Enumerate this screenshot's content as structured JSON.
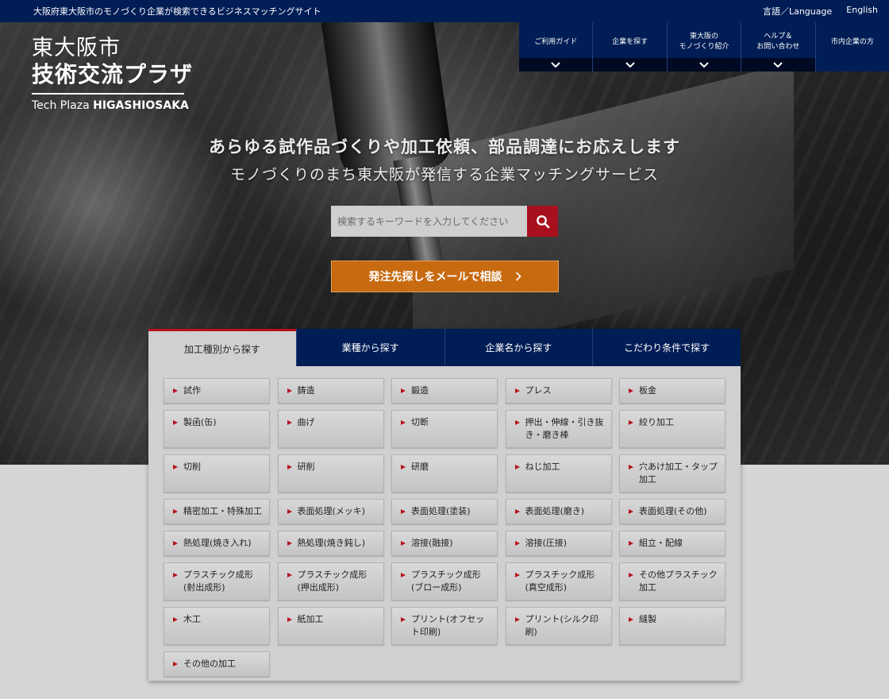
{
  "topbar": {
    "tagline": "大阪府東大阪市のモノづくり企業が検索できるビジネスマッチングサイト",
    "language": "言語／Language",
    "english": "English"
  },
  "logo": {
    "line1": "東大阪市",
    "line2": "技術交流プラザ",
    "line3_a": "Tech Plaza ",
    "line3_b": "HIGASHIOSAKA"
  },
  "nav": [
    {
      "line1": "ご利用ガイド",
      "line2": "",
      "has_chevron": true
    },
    {
      "line1": "企業を探す",
      "line2": "",
      "has_chevron": true
    },
    {
      "line1": "東大阪の",
      "line2": "モノづくり紹介",
      "has_chevron": true
    },
    {
      "line1": "ヘルプ＆",
      "line2": "お問い合わせ",
      "has_chevron": true
    },
    {
      "line1": "市内企業の方",
      "line2": "",
      "has_chevron": false
    }
  ],
  "hero": {
    "title": "あらゆる試作品づくりや加工依頼、部品調達にお応えします",
    "subtitle": "モノづくりのまち東大阪が発信する企業マッチングサービス",
    "search_placeholder": "検索するキーワードを入力してください",
    "cta_label": "発注先探しをメールで相談",
    "cta_icon": "chevron-right-icon",
    "search_icon": "search-icon"
  },
  "tabs": [
    {
      "label": "加工種別から探す",
      "active": true
    },
    {
      "label": "業種から探す",
      "active": false
    },
    {
      "label": "企業名から探す",
      "active": false
    },
    {
      "label": "こだわり条件で探す",
      "active": false
    }
  ],
  "categories": [
    [
      "試作"
    ],
    [
      "鋳造"
    ],
    [
      "鍛造"
    ],
    [
      "プレス"
    ],
    [
      "板金"
    ],
    [
      "製函(缶)"
    ],
    [
      "曲げ"
    ],
    [
      "切断"
    ],
    [
      "押出・伸線・引き抜",
      "き・磨き棒"
    ],
    [
      "絞り加工"
    ],
    [
      "切削"
    ],
    [
      "研削"
    ],
    [
      "研磨"
    ],
    [
      "ねじ加工"
    ],
    [
      "穴あけ加工・タップ",
      "加工"
    ],
    [
      "精密加工・特殊加工"
    ],
    [
      "表面処理(メッキ)"
    ],
    [
      "表面処理(塗装)"
    ],
    [
      "表面処理(磨き)"
    ],
    [
      "表面処理(その他)"
    ],
    [
      "熱処理(焼き入れ)"
    ],
    [
      "熱処理(焼き鈍し)"
    ],
    [
      "溶接(融接)"
    ],
    [
      "溶接(圧接)"
    ],
    [
      "組立・配線"
    ],
    [
      "プラスチック成形",
      "(射出成形)"
    ],
    [
      "プラスチック成形",
      "(押出成形)"
    ],
    [
      "プラスチック成形",
      "(ブロー成形)"
    ],
    [
      "プラスチック成形",
      "(真空成形)"
    ],
    [
      "その他プラスチック",
      "加工"
    ],
    [
      "木工"
    ],
    [
      "紙加工"
    ],
    [
      "プリント(オフセッ",
      "ト印刷)"
    ],
    [
      "プリント(シルク印",
      "刷)"
    ],
    [
      "縫製"
    ],
    [
      "その他の加工"
    ]
  ],
  "colors": {
    "navy": "#001d55",
    "accent_red": "#b5121b",
    "cta_orange": "#c76a10"
  }
}
